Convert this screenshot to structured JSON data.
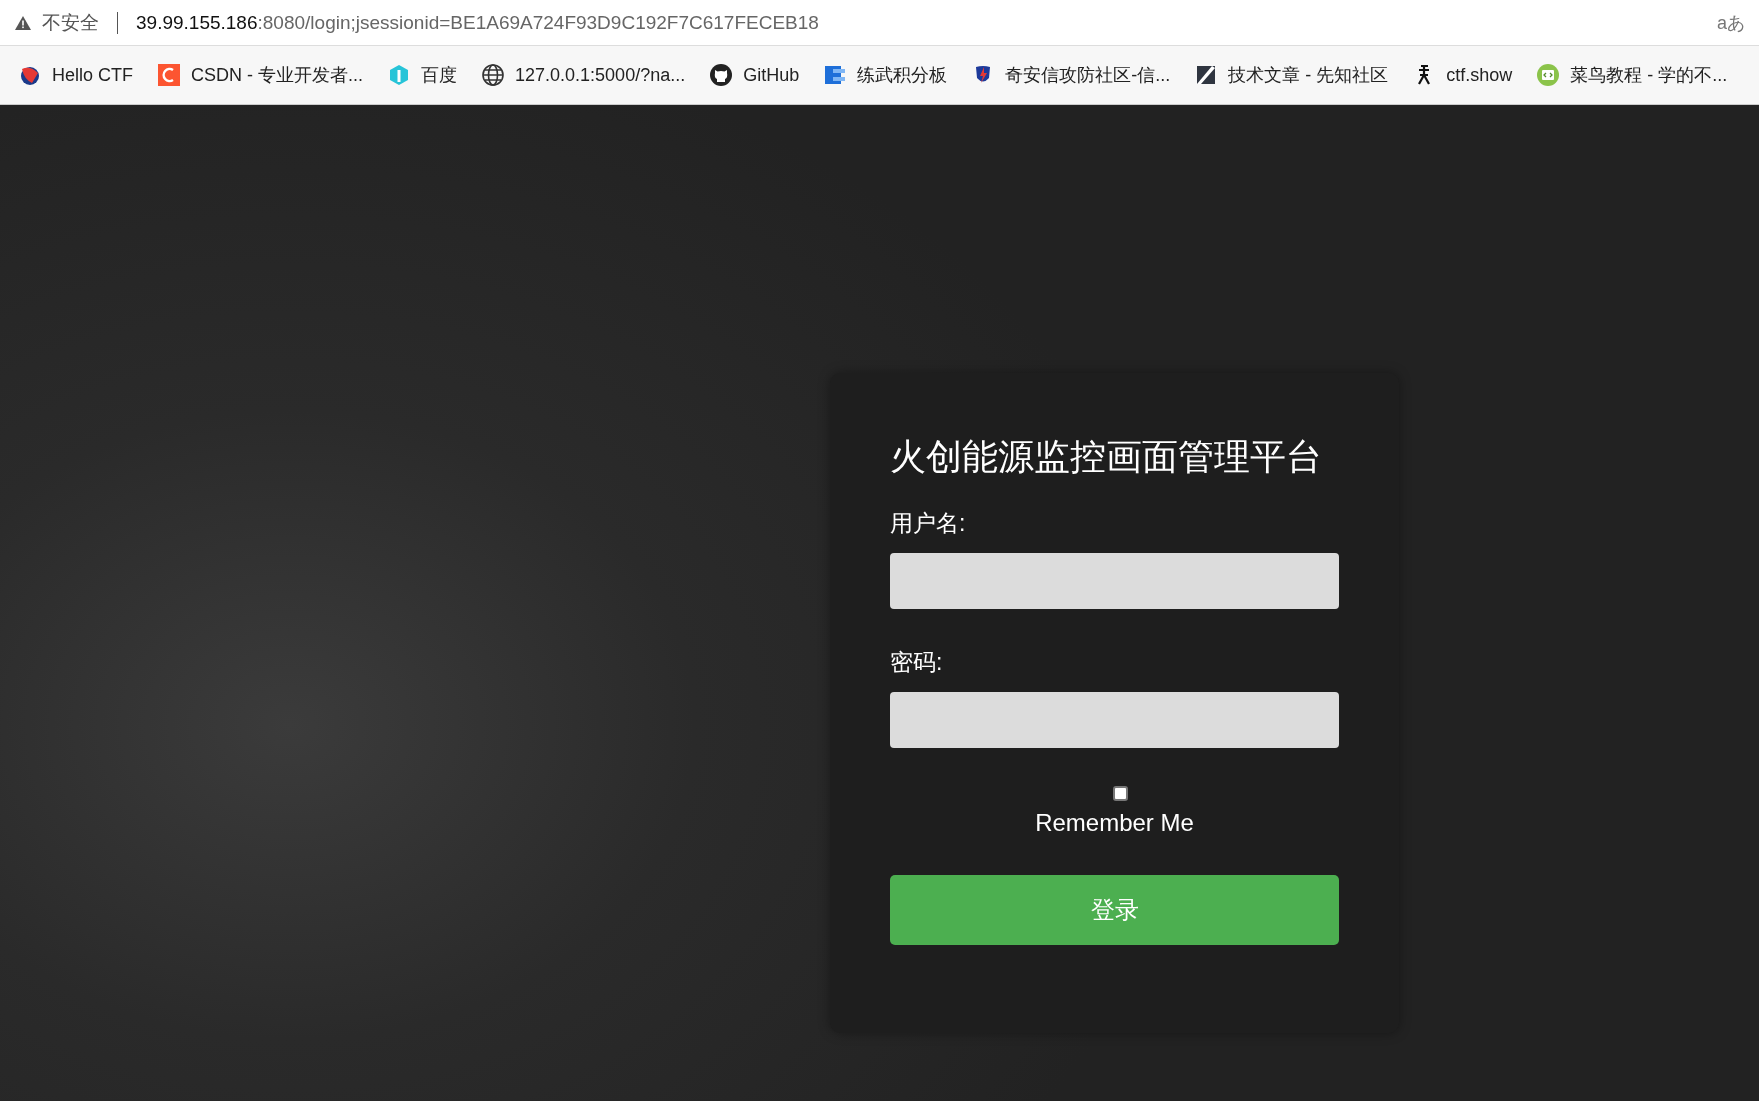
{
  "address_bar": {
    "security_label": "不安全",
    "url_host": "39.99.155.186",
    "url_rest": ":8080/login;jsessionid=BE1A69A724F93D9C192F7C617FECEB18",
    "reader_label": "aあ"
  },
  "bookmarks": [
    {
      "label": "Hello CTF",
      "kind": "ctf"
    },
    {
      "label": "CSDN - 专业开发者...",
      "kind": "csdn"
    },
    {
      "label": "百度",
      "kind": "baidu"
    },
    {
      "label": "127.0.0.1:5000/?na...",
      "kind": "globe"
    },
    {
      "label": "GitHub",
      "kind": "github"
    },
    {
      "label": "练武积分板",
      "kind": "board"
    },
    {
      "label": "奇安信攻防社区-信...",
      "kind": "shield"
    },
    {
      "label": "技术文章 - 先知社区",
      "kind": "slash"
    },
    {
      "label": "ctf.show",
      "kind": "figure"
    },
    {
      "label": "菜鸟教程 - 学的不...",
      "kind": "code"
    }
  ],
  "login": {
    "title": "火创能源监控画面管理平台",
    "username_label": "用户名:",
    "password_label": "密码:",
    "remember": {
      "label": "Remember Me",
      "checked": false
    },
    "submit": "登录"
  }
}
